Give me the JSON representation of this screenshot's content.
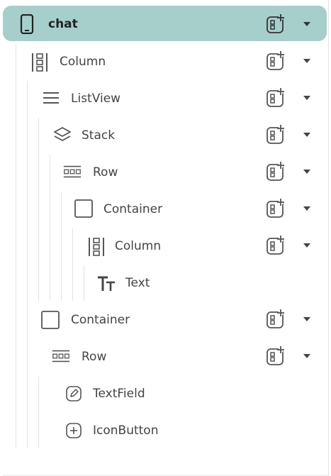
{
  "tree": {
    "items": [
      {
        "label": "chat",
        "icon": "phone-icon",
        "selected": true,
        "has_add": true
      },
      {
        "label": "Column",
        "icon": "column-icon",
        "has_add": true
      },
      {
        "label": "ListView",
        "icon": "list-icon",
        "has_add": true
      },
      {
        "label": "Stack",
        "icon": "stack-icon",
        "has_add": true
      },
      {
        "label": "Row",
        "icon": "row-icon",
        "has_add": true
      },
      {
        "label": "Container",
        "icon": "container-icon",
        "has_add": true
      },
      {
        "label": "Column",
        "icon": "column-icon",
        "has_add": true
      },
      {
        "label": "Text",
        "icon": "text-icon",
        "has_add": false
      },
      {
        "label": "Container",
        "icon": "container-icon",
        "has_add": true
      },
      {
        "label": "Row",
        "icon": "row-icon",
        "has_add": true
      },
      {
        "label": "TextField",
        "icon": "edit-icon",
        "has_add": false
      },
      {
        "label": "IconButton",
        "icon": "plus-box-icon",
        "has_add": false
      }
    ]
  },
  "colors": {
    "selected_bg": "#a6cfcb",
    "icon": "#555555",
    "text": "#444444",
    "guide_line": "#e3e3e3"
  }
}
